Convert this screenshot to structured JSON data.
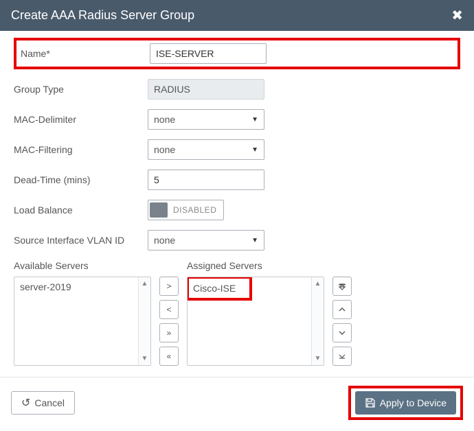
{
  "header": {
    "title": "Create AAA Radius Server Group"
  },
  "form": {
    "name": {
      "label": "Name*",
      "value": "ISE-SERVER"
    },
    "group_type": {
      "label": "Group Type",
      "value": "RADIUS"
    },
    "mac_delimiter": {
      "label": "MAC-Delimiter",
      "value": "none"
    },
    "mac_filtering": {
      "label": "MAC-Filtering",
      "value": "none"
    },
    "dead_time": {
      "label": "Dead-Time (mins)",
      "value": "5"
    },
    "load_balance": {
      "label": "Load Balance",
      "state": "DISABLED"
    },
    "source_vlan": {
      "label": "Source Interface VLAN ID",
      "value": "none"
    }
  },
  "servers": {
    "available_title": "Available Servers",
    "assigned_title": "Assigned Servers",
    "available": [
      "server-2019"
    ],
    "assigned": [
      "Cisco-ISE"
    ]
  },
  "footer": {
    "cancel": "Cancel",
    "apply": "Apply to Device"
  }
}
